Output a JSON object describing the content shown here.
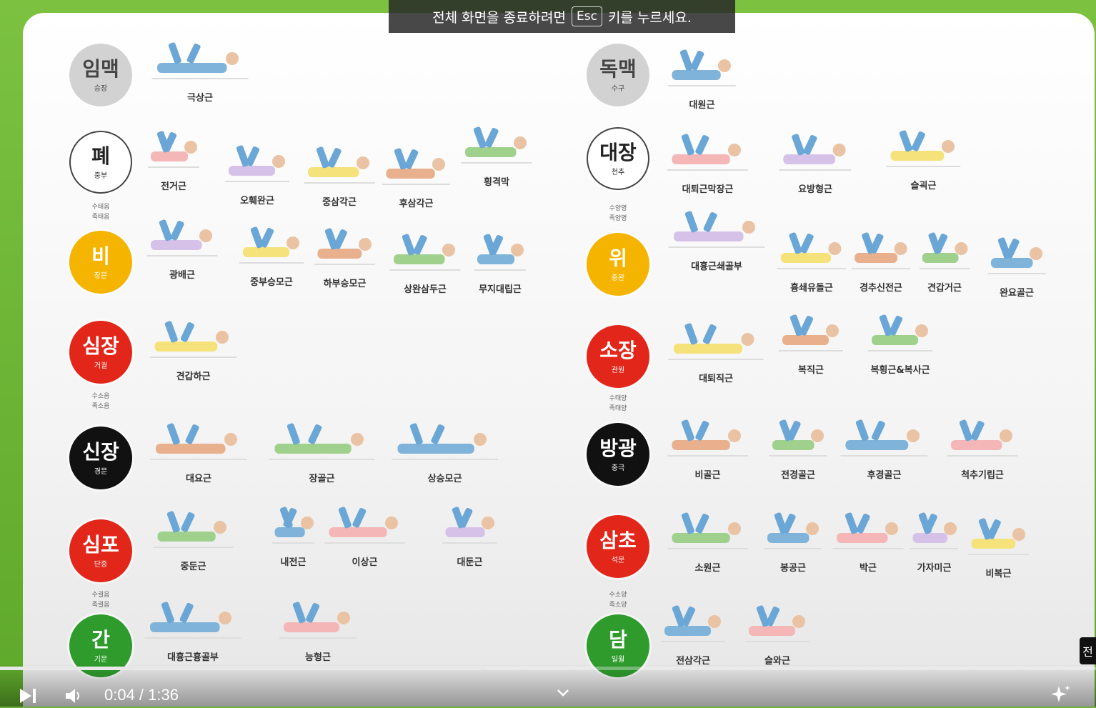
{
  "banner": {
    "before": "전체 화면을 종료하려면",
    "key": "Esc",
    "after": "키를 누르세요."
  },
  "left": [
    {
      "name": "임맥",
      "sub": "승장",
      "note": "",
      "items": [
        "극상근"
      ]
    },
    {
      "name": "폐",
      "sub": "중부",
      "note": "수태음\n족태음",
      "items": [
        "전거근",
        "오훼완근",
        "중삼각근",
        "후삼각근",
        "횡격막"
      ]
    },
    {
      "name": "비",
      "sub": "장문",
      "note": "",
      "items": [
        "광배근",
        "중부승모근",
        "하부승모근",
        "상완삼두근",
        "무지대립근"
      ]
    },
    {
      "name": "심장",
      "sub": "거궐",
      "note": "수소음\n족소음",
      "items": [
        "견갑하근"
      ]
    },
    {
      "name": "신장",
      "sub": "경문",
      "note": "",
      "items": [
        "대요근",
        "장골근",
        "상승모근"
      ]
    },
    {
      "name": "심포",
      "sub": "단중",
      "note": "수궐음\n족궐음",
      "items": [
        "중둔근",
        "내전근",
        "이상근",
        "대둔근"
      ]
    },
    {
      "name": "간",
      "sub": "기문",
      "note": "",
      "items": [
        "대흉근흉골부",
        "능형근"
      ]
    }
  ],
  "right": [
    {
      "name": "독맥",
      "sub": "수구",
      "note": "",
      "items": [
        "대원근"
      ]
    },
    {
      "name": "대장",
      "sub": "천추",
      "note": "수양명\n족양명",
      "items": [
        "대퇴근막장근",
        "요방형근",
        "슬괵근"
      ]
    },
    {
      "name": "위",
      "sub": "중완",
      "note": "",
      "items": [
        "대흉근쇄골부",
        "흉쇄유돌근",
        "경추신전근",
        "견갑거근",
        "완요골근"
      ]
    },
    {
      "name": "소장",
      "sub": "관원",
      "note": "수태양\n족태양",
      "items": [
        "대퇴직근",
        "복직근",
        "복횡근&복사근"
      ]
    },
    {
      "name": "방광",
      "sub": "중극",
      "note": "",
      "items": [
        "비골근",
        "전경골근",
        "후경골근",
        "척추기립근"
      ]
    },
    {
      "name": "삼초",
      "sub": "석문",
      "note": "수소양\n족소양",
      "items": [
        "소원근",
        "봉공근",
        "박근",
        "가자미근",
        "비복근"
      ]
    },
    {
      "name": "담",
      "sub": "일월",
      "note": "",
      "items": [
        "전삼각근",
        "슬와근"
      ]
    }
  ],
  "player": {
    "time": "0:04 / 1:36",
    "progress": 0.443,
    "side_tab": "전"
  },
  "colors": {
    "grey": "#d2d2d2",
    "white": "#ffffff",
    "yellow": "#f5b400",
    "red": "#e3261a",
    "black": "#111111",
    "green": "#2e9b2c"
  }
}
